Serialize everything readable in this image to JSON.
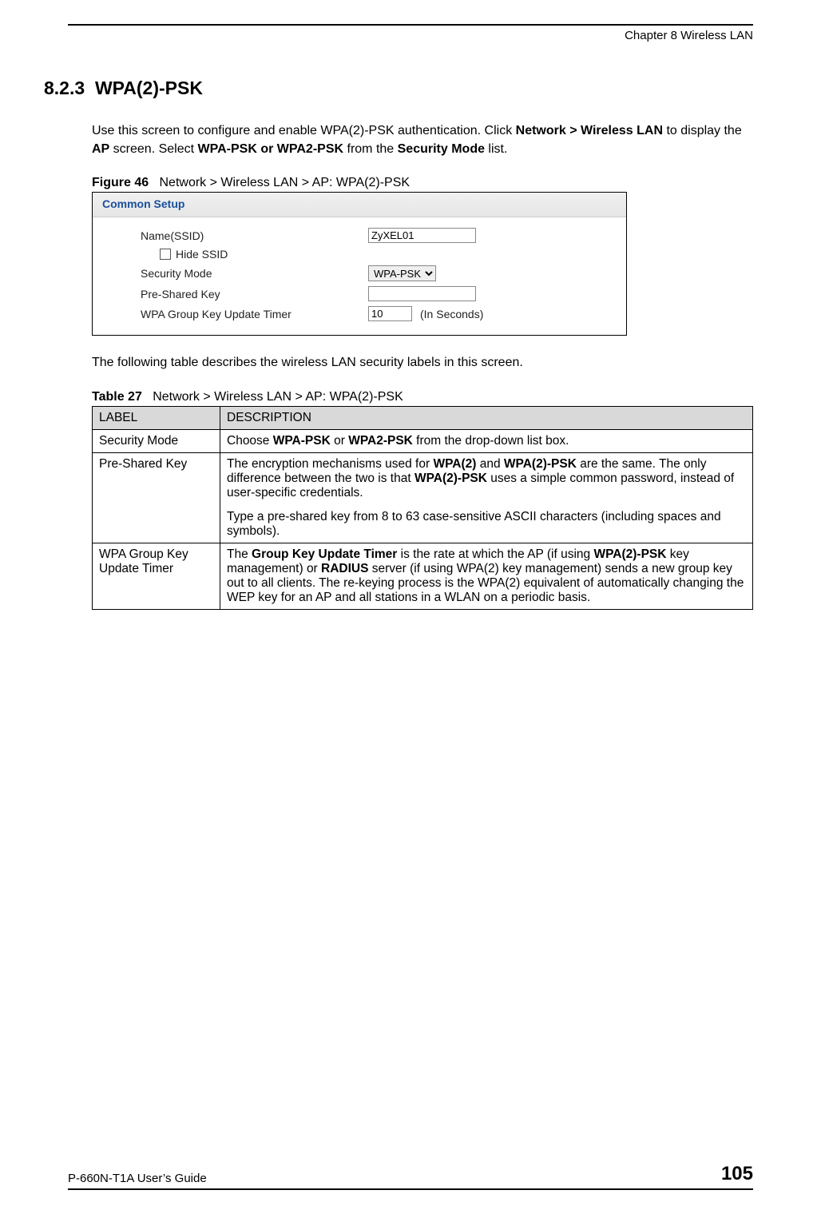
{
  "header": {
    "chapter": "Chapter 8 Wireless LAN"
  },
  "section": {
    "number": "8.2.3",
    "title": "WPA(2)-PSK"
  },
  "para1": {
    "pre": "Use this screen to configure and enable WPA(2)-PSK authentication. Click ",
    "b1": "Network > Wireless LAN",
    "mid1": " to display the ",
    "b2": "AP",
    "mid2": " screen. Select ",
    "b3": "WPA-PSK or WPA2-PSK",
    "mid3": " from the ",
    "b4": "Security Mode",
    "post": " list."
  },
  "figure": {
    "label": "Figure 46",
    "caption": "Network > Wireless LAN > AP: WPA(2)-PSK",
    "panel_title": "Common Setup",
    "rows": {
      "ssid_label": "Name(SSID)",
      "ssid_value": "ZyXEL01",
      "hide_ssid_label": "Hide SSID",
      "sec_label": "Security Mode",
      "sec_value": "WPA-PSK",
      "psk_label": "Pre-Shared Key",
      "psk_value": "",
      "timer_label": "WPA Group Key Update Timer",
      "timer_value": "10",
      "timer_unit": "(In Seconds)"
    }
  },
  "para2": "The following table describes the wireless LAN security labels in this screen.",
  "table": {
    "label": "Table 27",
    "caption": "Network > Wireless LAN > AP: WPA(2)-PSK",
    "head_label": "LABEL",
    "head_desc": "DESCRIPTION",
    "rows": [
      {
        "label": "Security Mode",
        "desc": {
          "pre": "Choose ",
          "b1": "WPA-PSK",
          "mid": " or ",
          "b2": "WPA2-PSK",
          "post": " from the drop-down list box."
        }
      },
      {
        "label": "Pre-Shared Key",
        "desc": {
          "p1_pre": "The encryption mechanisms used for ",
          "p1_b1": "WPA(2)",
          "p1_mid1": " and ",
          "p1_b2": "WPA(2)-PSK",
          "p1_mid2": " are the same. The only difference between the two is that ",
          "p1_b3": "WPA(2)-PSK",
          "p1_post": " uses a simple common password, instead of user-specific credentials.",
          "p2": "Type a pre-shared key from 8 to 63 case-sensitive ASCII characters (including spaces and symbols)."
        }
      },
      {
        "label": "WPA Group Key Update Timer",
        "desc": {
          "pre": "The ",
          "b1": "Group Key Update Timer",
          "mid1": " is the rate at which the AP (if using ",
          "b2": "WPA(2)-PSK",
          "mid2": " key management) or ",
          "b3": "RADIUS",
          "post": " server (if using WPA(2) key management) sends a new group key out to all clients. The re-keying process is the WPA(2) equivalent of automatically changing the WEP key for an AP and all stations in a WLAN on a periodic basis."
        }
      }
    ]
  },
  "footer": {
    "guide": "P-660N-T1A User’s Guide",
    "page": "105"
  }
}
